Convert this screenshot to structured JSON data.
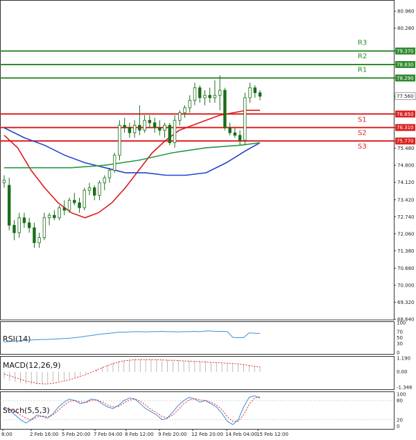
{
  "chart_data": {
    "type": "candlestick",
    "price_axis": {
      "labels": [
        "80.960",
        "80.280",
        "79.370",
        "78.830",
        "78.290",
        "77.560",
        "76.850",
        "76.310",
        "75.770",
        "75.480",
        "74.800",
        "74.120",
        "73.420",
        "72.740",
        "72.060",
        "71.380",
        "70.680",
        "70.000",
        "69.320",
        "68.640"
      ],
      "range": [
        68.64,
        81.3
      ]
    },
    "time_axis": {
      "labels": [
        "8:00",
        "2 Feb 16:00",
        "5 Feb 20:00",
        "7 Feb 04:00",
        "8 Feb 12:00",
        "9 Feb 20:00",
        "12 Feb 20:00",
        "14 Feb 04:00",
        "15 Feb 12:00"
      ]
    },
    "current_price": "77.560",
    "levels": [
      {
        "name": "R3",
        "value": 79.37,
        "label": "79.370",
        "color": "#2e8b2e"
      },
      {
        "name": "R2",
        "value": 78.83,
        "label": "78.830",
        "color": "#2e8b2e"
      },
      {
        "name": "R1",
        "value": 78.29,
        "label": "78.290",
        "color": "#2e8b2e"
      },
      {
        "name": "S1",
        "value": 76.85,
        "label": "76.850",
        "color": "#dd2222"
      },
      {
        "name": "S2",
        "value": 76.31,
        "label": "76.310",
        "color": "#dd2222"
      },
      {
        "name": "S3",
        "value": 75.77,
        "label": "75.770",
        "color": "#dd2222"
      }
    ],
    "candles": [
      {
        "o": 74.1,
        "h": 74.4,
        "l": 73.9,
        "c": 74.2
      },
      {
        "o": 74.0,
        "h": 74.3,
        "l": 72.2,
        "c": 72.4
      },
      {
        "o": 72.4,
        "h": 72.6,
        "l": 71.8,
        "c": 72.1
      },
      {
        "o": 72.1,
        "h": 72.9,
        "l": 71.9,
        "c": 72.7
      },
      {
        "o": 72.7,
        "h": 72.9,
        "l": 72.3,
        "c": 72.5
      },
      {
        "o": 72.5,
        "h": 72.7,
        "l": 72.1,
        "c": 72.3
      },
      {
        "o": 72.3,
        "h": 72.5,
        "l": 71.5,
        "c": 71.7
      },
      {
        "o": 71.7,
        "h": 72.1,
        "l": 71.5,
        "c": 71.9
      },
      {
        "o": 71.9,
        "h": 72.9,
        "l": 71.8,
        "c": 72.7
      },
      {
        "o": 72.7,
        "h": 72.9,
        "l": 72.4,
        "c": 72.8
      },
      {
        "o": 72.8,
        "h": 73.0,
        "l": 72.6,
        "c": 72.7
      },
      {
        "o": 72.7,
        "h": 73.2,
        "l": 72.6,
        "c": 73.1
      },
      {
        "o": 73.1,
        "h": 73.4,
        "l": 72.8,
        "c": 73.0
      },
      {
        "o": 73.0,
        "h": 73.5,
        "l": 72.9,
        "c": 73.4
      },
      {
        "o": 73.4,
        "h": 73.7,
        "l": 73.2,
        "c": 73.3
      },
      {
        "o": 73.3,
        "h": 73.5,
        "l": 72.9,
        "c": 73.1
      },
      {
        "o": 73.1,
        "h": 73.9,
        "l": 73.0,
        "c": 73.8
      },
      {
        "o": 73.8,
        "h": 74.1,
        "l": 73.6,
        "c": 73.9
      },
      {
        "o": 73.9,
        "h": 74.0,
        "l": 73.4,
        "c": 73.6
      },
      {
        "o": 73.6,
        "h": 74.2,
        "l": 73.4,
        "c": 74.1
      },
      {
        "o": 74.1,
        "h": 74.4,
        "l": 73.8,
        "c": 74.3
      },
      {
        "o": 74.3,
        "h": 74.7,
        "l": 74.1,
        "c": 74.6
      },
      {
        "o": 74.6,
        "h": 75.3,
        "l": 74.5,
        "c": 75.2
      },
      {
        "o": 75.2,
        "h": 76.6,
        "l": 75.0,
        "c": 76.4
      },
      {
        "o": 76.4,
        "h": 76.7,
        "l": 76.1,
        "c": 76.3
      },
      {
        "o": 76.3,
        "h": 76.5,
        "l": 75.9,
        "c": 76.1
      },
      {
        "o": 76.1,
        "h": 76.6,
        "l": 75.9,
        "c": 76.4
      },
      {
        "o": 76.4,
        "h": 77.2,
        "l": 76.0,
        "c": 76.2
      },
      {
        "o": 76.2,
        "h": 76.8,
        "l": 76.1,
        "c": 76.6
      },
      {
        "o": 76.6,
        "h": 76.8,
        "l": 76.3,
        "c": 76.5
      },
      {
        "o": 76.5,
        "h": 76.7,
        "l": 76.1,
        "c": 76.3
      },
      {
        "o": 76.3,
        "h": 76.6,
        "l": 76.0,
        "c": 76.2
      },
      {
        "o": 76.2,
        "h": 76.5,
        "l": 75.9,
        "c": 76.4
      },
      {
        "o": 76.4,
        "h": 76.5,
        "l": 75.6,
        "c": 75.7
      },
      {
        "o": 75.7,
        "h": 76.8,
        "l": 75.5,
        "c": 76.6
      },
      {
        "o": 76.6,
        "h": 77.0,
        "l": 76.4,
        "c": 76.9
      },
      {
        "o": 76.9,
        "h": 77.2,
        "l": 76.7,
        "c": 77.1
      },
      {
        "o": 77.1,
        "h": 77.6,
        "l": 76.9,
        "c": 77.4
      },
      {
        "o": 77.4,
        "h": 78.1,
        "l": 77.2,
        "c": 77.9
      },
      {
        "o": 77.9,
        "h": 78.0,
        "l": 77.3,
        "c": 77.5
      },
      {
        "o": 77.5,
        "h": 77.8,
        "l": 77.2,
        "c": 77.6
      },
      {
        "o": 77.6,
        "h": 77.9,
        "l": 77.3,
        "c": 77.5
      },
      {
        "o": 77.5,
        "h": 78.2,
        "l": 77.3,
        "c": 77.6
      },
      {
        "o": 77.6,
        "h": 78.4,
        "l": 77.0,
        "c": 77.8
      },
      {
        "o": 77.8,
        "h": 77.9,
        "l": 76.2,
        "c": 76.3
      },
      {
        "o": 76.3,
        "h": 76.5,
        "l": 76.0,
        "c": 76.1
      },
      {
        "o": 76.1,
        "h": 76.3,
        "l": 75.9,
        "c": 76.0
      },
      {
        "o": 76.0,
        "h": 76.2,
        "l": 75.6,
        "c": 75.8
      },
      {
        "o": 75.8,
        "h": 77.7,
        "l": 75.6,
        "c": 77.5
      },
      {
        "o": 77.5,
        "h": 78.1,
        "l": 77.3,
        "c": 77.9
      },
      {
        "o": 77.9,
        "h": 78.0,
        "l": 77.5,
        "c": 77.7
      },
      {
        "o": 77.7,
        "h": 77.8,
        "l": 77.4,
        "c": 77.56
      }
    ],
    "moving_averages": [
      {
        "color": "#e01818",
        "values": [
          [
            0,
            76.0
          ],
          [
            4,
            75.5
          ],
          [
            8,
            74.6
          ],
          [
            12,
            73.9
          ],
          [
            16,
            73.3
          ],
          [
            20,
            72.9
          ],
          [
            24,
            72.7
          ],
          [
            28,
            72.9
          ],
          [
            32,
            73.3
          ],
          [
            36,
            73.9
          ],
          [
            40,
            74.6
          ],
          [
            44,
            75.3
          ],
          [
            48,
            75.8
          ],
          [
            52,
            76.2
          ],
          [
            56,
            76.4
          ],
          [
            60,
            76.6
          ],
          [
            64,
            76.8
          ],
          [
            68,
            76.9
          ],
          [
            72,
            77.0
          ],
          [
            76,
            77.0
          ]
        ]
      },
      {
        "color": "#2244cc",
        "values": [
          [
            0,
            76.3
          ],
          [
            6,
            75.9
          ],
          [
            12,
            75.6
          ],
          [
            18,
            75.2
          ],
          [
            24,
            74.9
          ],
          [
            30,
            74.7
          ],
          [
            36,
            74.5
          ],
          [
            42,
            74.5
          ],
          [
            48,
            74.4
          ],
          [
            54,
            74.4
          ],
          [
            60,
            74.5
          ],
          [
            66,
            74.9
          ],
          [
            72,
            75.4
          ],
          [
            76,
            75.7
          ]
        ]
      },
      {
        "color": "#229944",
        "values": [
          [
            0,
            74.7
          ],
          [
            10,
            74.7
          ],
          [
            20,
            74.7
          ],
          [
            30,
            74.8
          ],
          [
            40,
            75.0
          ],
          [
            50,
            75.3
          ],
          [
            60,
            75.5
          ],
          [
            70,
            75.6
          ],
          [
            76,
            75.7
          ]
        ]
      }
    ],
    "rsi": {
      "title": "RSI(14)",
      "labels": [
        "100",
        "70",
        "50",
        "30",
        "0"
      ],
      "values": [
        35,
        37,
        38,
        40,
        41,
        42,
        43,
        44,
        44,
        45,
        46,
        47,
        48,
        50,
        52,
        55,
        57,
        60,
        62,
        64,
        66,
        68,
        68,
        69,
        70,
        70,
        69,
        70,
        70,
        71,
        70,
        70,
        69,
        70,
        70,
        71,
        70,
        72,
        72,
        71,
        71,
        70,
        51,
        50,
        50,
        66,
        65,
        64
      ]
    },
    "macd": {
      "title": "MACD(12,26,9)",
      "labels": [
        "1.190",
        "0.00",
        "-1.346"
      ],
      "hist": [
        -0.6,
        -0.8,
        -0.9,
        -1.0,
        -1.05,
        -1.1,
        -1.1,
        -1.05,
        -1.0,
        -0.9,
        -0.8,
        -0.7,
        -0.6,
        -0.5,
        -0.35,
        -0.2,
        0.0,
        0.2,
        0.4,
        0.6,
        0.8,
        0.9,
        1.0,
        1.05,
        1.1,
        1.1,
        1.1,
        1.1,
        1.1,
        1.05,
        1.05,
        1.0,
        1.0,
        0.95,
        0.95,
        0.95,
        0.9,
        0.9,
        0.85,
        0.8,
        0.8,
        0.75,
        0.7,
        0.7,
        0.6,
        0.6,
        0.5,
        0.5
      ],
      "signal": [
        -0.2,
        -0.35,
        -0.5,
        -0.65,
        -0.8,
        -0.9,
        -1.0,
        -1.05,
        -1.05,
        -1.0,
        -0.9,
        -0.8,
        -0.7,
        -0.55,
        -0.4,
        -0.25,
        -0.05,
        0.15,
        0.35,
        0.55,
        0.7,
        0.85,
        0.95,
        1.0,
        1.05,
        1.05,
        1.05,
        1.05,
        1.05,
        1.03,
        1.0,
        1.0,
        0.98,
        0.95,
        0.93,
        0.9,
        0.88,
        0.85,
        0.82,
        0.8,
        0.78,
        0.75,
        0.72,
        0.68,
        0.62,
        0.55,
        0.48,
        0.4
      ]
    },
    "stoch": {
      "title": "Stoch(5,5,3)",
      "labels": [
        "100",
        "80",
        "20",
        "0"
      ],
      "k": [
        60,
        50,
        35,
        20,
        10,
        20,
        35,
        30,
        25,
        40,
        60,
        75,
        85,
        80,
        70,
        75,
        85,
        82,
        70,
        60,
        55,
        65,
        80,
        88,
        85,
        70,
        55,
        45,
        35,
        20,
        25,
        45,
        65,
        80,
        90,
        85,
        75,
        80,
        70,
        60,
        40,
        15,
        5,
        20,
        60,
        90,
        95,
        88
      ],
      "d": [
        55,
        52,
        45,
        35,
        25,
        20,
        28,
        32,
        28,
        35,
        50,
        65,
        78,
        80,
        76,
        74,
        80,
        82,
        76,
        66,
        60,
        62,
        72,
        82,
        85,
        78,
        65,
        52,
        42,
        30,
        26,
        35,
        52,
        70,
        82,
        86,
        82,
        80,
        75,
        66,
        52,
        30,
        15,
        15,
        35,
        68,
        88,
        92
      ]
    }
  }
}
